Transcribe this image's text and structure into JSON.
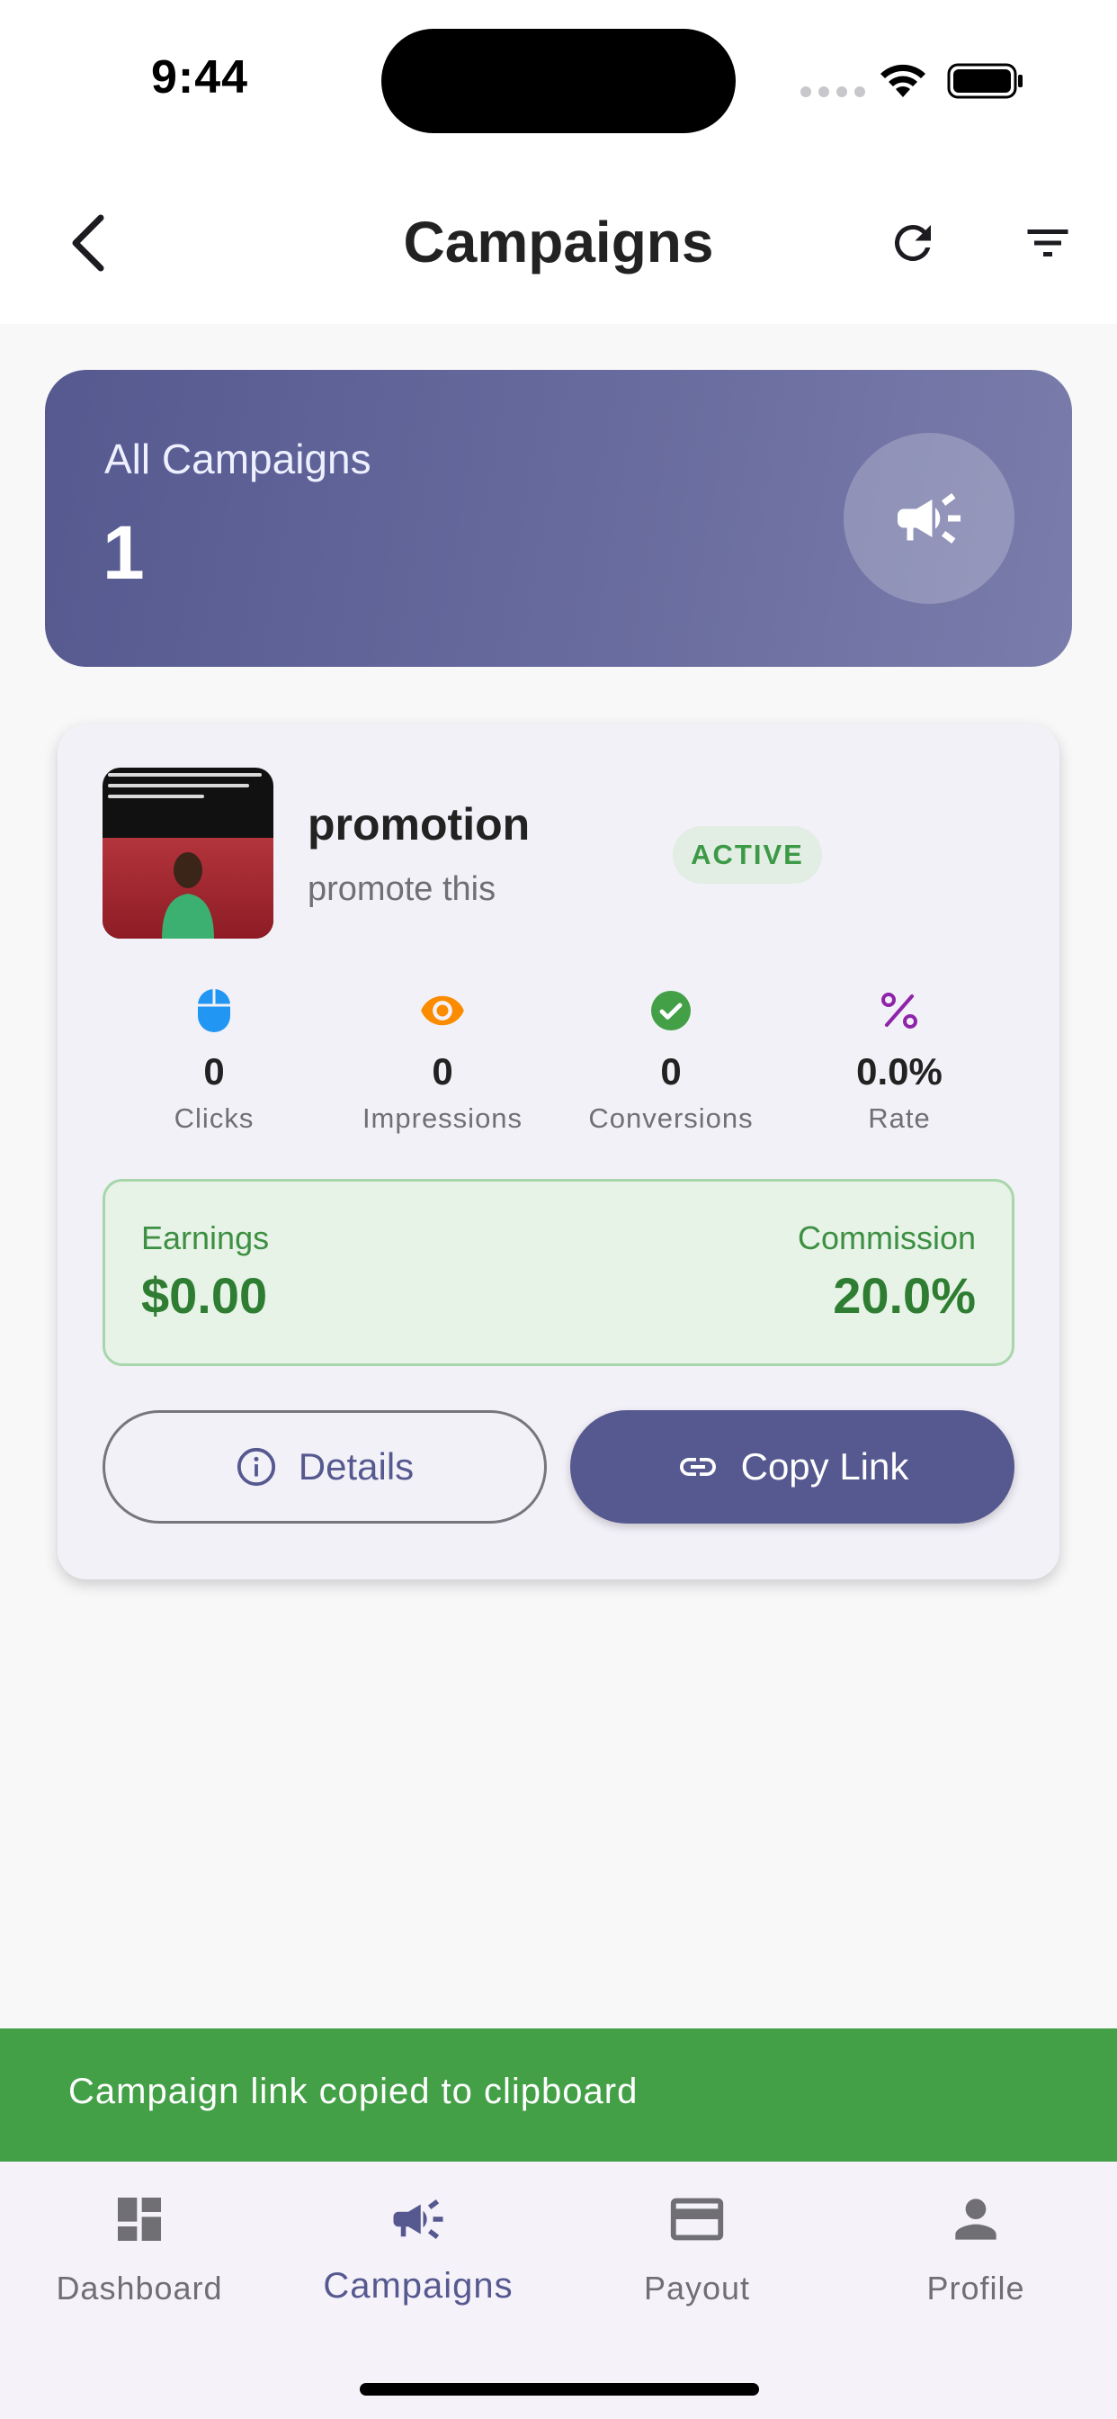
{
  "status_bar": {
    "time": "9:44"
  },
  "app_bar": {
    "title": "Campaigns"
  },
  "summary": {
    "label": "All Campaigns",
    "count": "1"
  },
  "campaign": {
    "name": "promotion",
    "description": "promote this",
    "status": "ACTIVE",
    "stats": [
      {
        "value": "0",
        "label": "Clicks",
        "icon": "mouse-icon",
        "color": "#2196f3"
      },
      {
        "value": "0",
        "label": "Impressions",
        "icon": "eye-icon",
        "color": "#fb8c00"
      },
      {
        "value": "0",
        "label": "Conversions",
        "icon": "check-circle-icon",
        "color": "#43a047"
      },
      {
        "value": "0.0%",
        "label": "Rate",
        "icon": "percent-icon",
        "color": "#8e24aa"
      }
    ],
    "earnings_label": "Earnings",
    "earnings_value": "$0.00",
    "commission_label": "Commission",
    "commission_value": "20.0%",
    "details_label": "Details",
    "copy_link_label": "Copy Link"
  },
  "snackbar": {
    "message": "Campaign link copied to clipboard"
  },
  "bottom_nav": [
    {
      "label": "Dashboard",
      "icon": "dashboard-icon",
      "active": false
    },
    {
      "label": "Campaigns",
      "icon": "megaphone-icon",
      "active": true
    },
    {
      "label": "Payout",
      "icon": "card-icon",
      "active": false
    },
    {
      "label": "Profile",
      "icon": "person-icon",
      "active": false
    }
  ],
  "colors": {
    "primary": "#56598f",
    "success": "#43a047",
    "earnings_text": "#2e7d32"
  }
}
